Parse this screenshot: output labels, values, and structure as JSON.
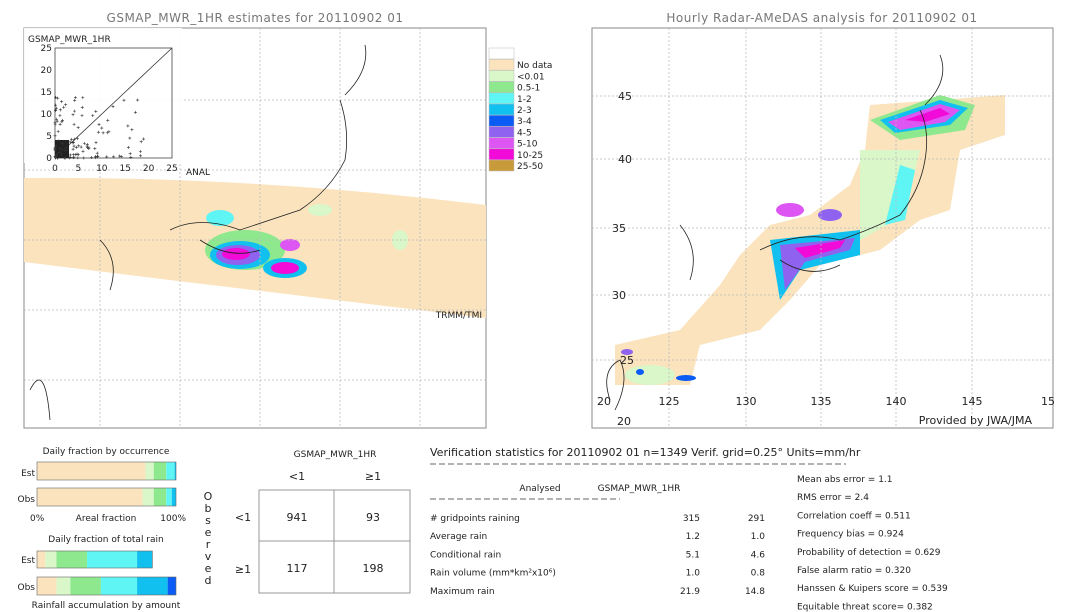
{
  "left_map": {
    "title": "GSMAP_MWR_1HR estimates for 20110902 01",
    "inset_title": "GSMAP_MWR_1HR",
    "inset_x_label": "ANAL",
    "inset_ticks": [
      "0",
      "5",
      "10",
      "15",
      "20",
      "25"
    ],
    "swath_label": "TRMM/TMI"
  },
  "right_map": {
    "title": "Hourly Radar-AMeDAS analysis for 20110902 01",
    "lon_ticks": [
      "125",
      "130",
      "135",
      "140",
      "145",
      "15"
    ],
    "lat_ticks": [
      "45",
      "40",
      "35",
      "30",
      "25",
      "20"
    ],
    "lat_ticks_lower": [
      "20"
    ],
    "credit": "Provided by JWA/JMA"
  },
  "legend": {
    "items": [
      {
        "label": "",
        "color": "#ffffff"
      },
      {
        "label": "No data",
        "color": "#fae3bd"
      },
      {
        "label": "<0.01",
        "color": "#d9f7c8"
      },
      {
        "label": "0.5-1",
        "color": "#8ee88e"
      },
      {
        "label": "1-2",
        "color": "#5ff5f5"
      },
      {
        "label": "2-3",
        "color": "#12c0ef"
      },
      {
        "label": "3-4",
        "color": "#0a5cf5"
      },
      {
        "label": "4-5",
        "color": "#8f62f0"
      },
      {
        "label": "5-10",
        "color": "#dd55f3"
      },
      {
        "label": "10-25",
        "color": "#f20ad8"
      },
      {
        "label": "25-50",
        "color": "#c99a3a"
      }
    ]
  },
  "occurrence": {
    "title": "Daily fraction by occurrence",
    "est_label": "Est",
    "obs_label": "Obs",
    "axis_left": "0%",
    "axis_mid": "Areal fraction",
    "axis_right": "100%",
    "est_fractions": [
      0.78,
      0.06,
      0.09,
      0.06,
      0.01
    ],
    "obs_fractions": [
      0.76,
      0.08,
      0.09,
      0.04,
      0.03
    ]
  },
  "total_rain": {
    "title": "Daily fraction of total rain",
    "est_label": "Est",
    "obs_label": "Obs",
    "caption": "Rainfall accumulation by amount",
    "est_fractions": [
      0.06,
      0.08,
      0.22,
      0.36,
      0.11
    ],
    "obs_fractions": [
      0.14,
      0.1,
      0.22,
      0.26,
      0.22,
      0.06
    ]
  },
  "contingency": {
    "header": "GSMAP_MWR_1HR",
    "col_labels": [
      "<1",
      "≥1"
    ],
    "row_labels": [
      "<1",
      "≥1"
    ],
    "side_label": "Observed",
    "cells": [
      [
        "941",
        "93"
      ],
      [
        "117",
        "198"
      ]
    ]
  },
  "stats": {
    "title": "Verification statistics for 20110902 01   n=1349   Verif. grid=0.25°   Units=mm/hr",
    "col_analysed": "Analysed",
    "col_gsmap": "GSMAP_MWR_1HR",
    "rows": [
      {
        "label": "# gridpoints raining",
        "analysed": "315",
        "gsmap": "291"
      },
      {
        "label": "Average rain",
        "analysed": "1.2",
        "gsmap": "1.0"
      },
      {
        "label": "Conditional rain",
        "analysed": "5.1",
        "gsmap": "4.6"
      },
      {
        "label": "Rain volume (mm*km²x10⁶)",
        "analysed": "1.0",
        "gsmap": "0.8"
      },
      {
        "label": "Maximum rain",
        "analysed": "21.9",
        "gsmap": "14.8"
      }
    ],
    "scores": [
      "Mean abs error = 1.1",
      "RMS error = 2.4",
      "Correlation coeff = 0.511",
      "Frequency bias = 0.924",
      "Probability of detection = 0.629",
      "False alarm ratio = 0.320",
      "Hanssen & Kuipers score = 0.539",
      "Equitable threat score= 0.382"
    ]
  }
}
